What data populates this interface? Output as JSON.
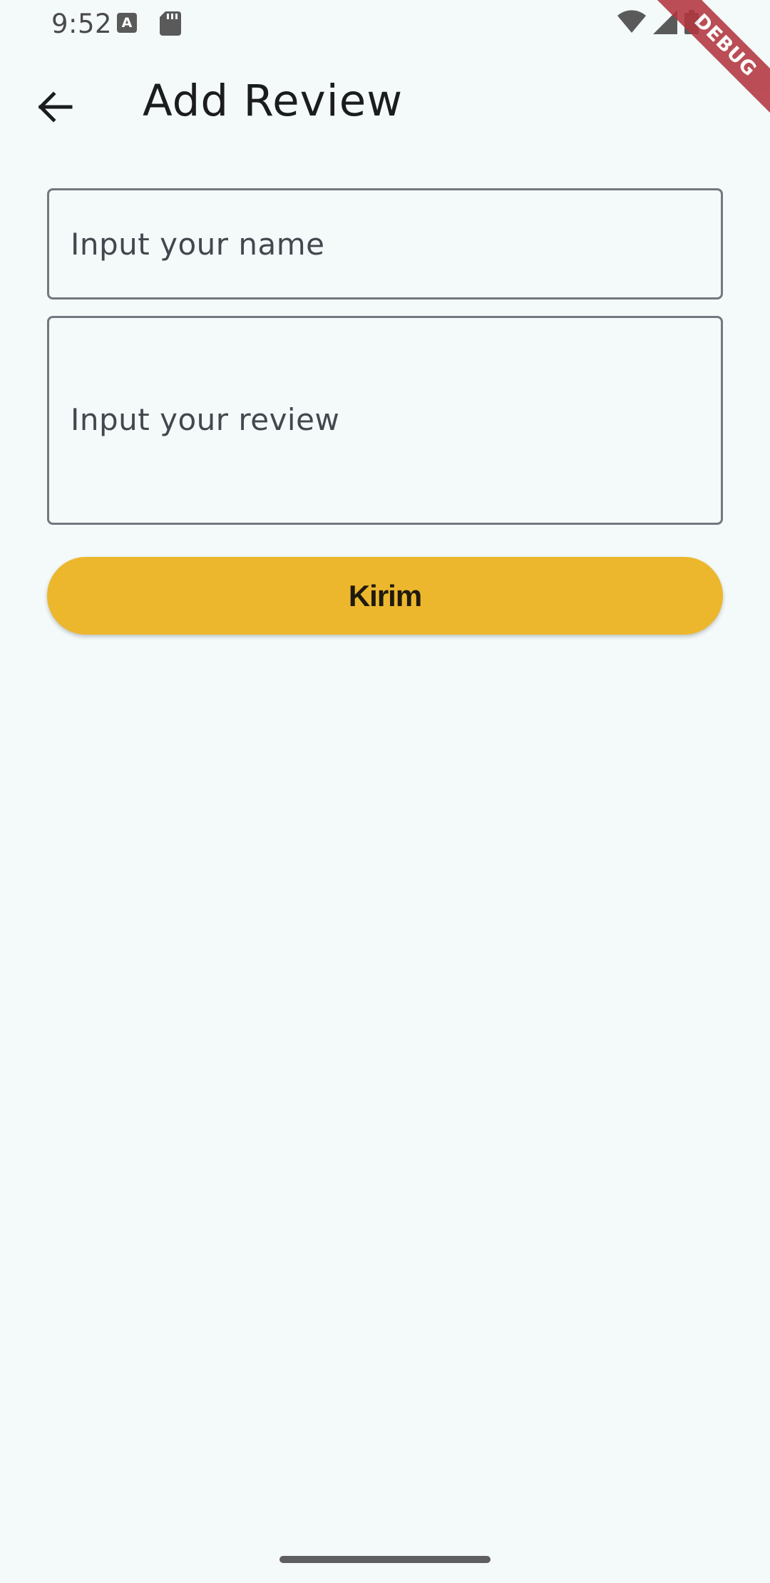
{
  "status_bar": {
    "time": "9:52",
    "icons": [
      "keyboard-a-icon",
      "sd-card-icon",
      "wifi-icon",
      "cell-signal-icon",
      "battery-icon"
    ]
  },
  "debug_banner": "DEBUG",
  "app_bar": {
    "back_icon": "arrow-back-icon",
    "title": "Add Review"
  },
  "form": {
    "name_placeholder": "Input your name",
    "review_placeholder": "Input your review",
    "submit_label": "Kirim"
  },
  "colors": {
    "background": "#f4fafa",
    "accent": "#ecb72d",
    "debug": "#b3363f",
    "border": "#73777f"
  }
}
